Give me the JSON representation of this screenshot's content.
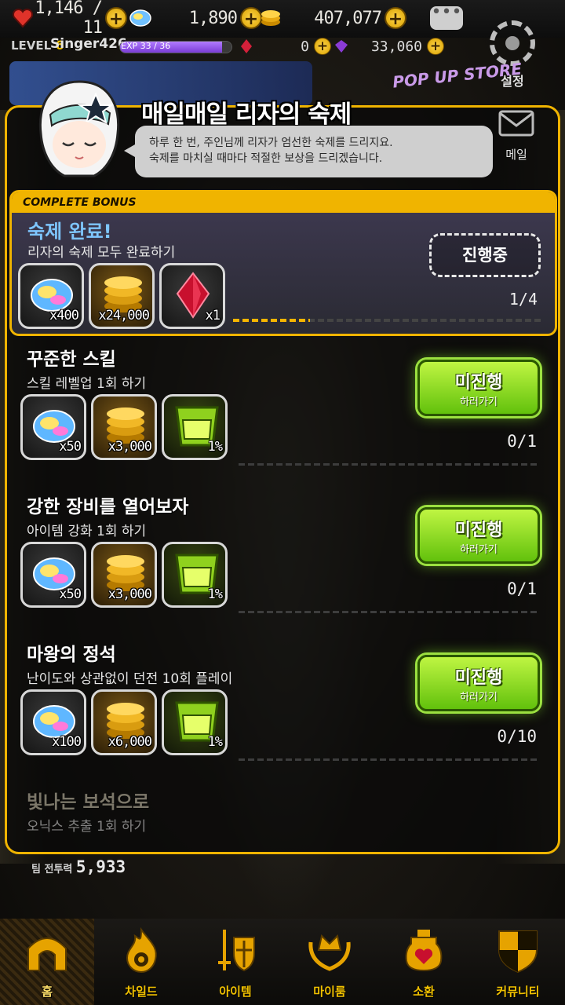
{
  "resources": {
    "hearts": "1,146 / 11",
    "gems": "1,890",
    "gold": "407,077"
  },
  "player": {
    "level_label": "LEVEL",
    "level": "6",
    "nickname": "Singer426",
    "exp_text": "EXP 33 / 36",
    "exp_fraction": 0.917,
    "red_crystal": "0",
    "purple_crystal": "33,060"
  },
  "settings_label": "설정",
  "popup_store": "POP UP STORE",
  "side_menu": {
    "mail": "메일"
  },
  "panel": {
    "title": "매일매일 리자의 숙제",
    "speech": "하루 한 번, 주인님께 리자가 엄선한 숙제를 드리지요.\n숙제를 마치실 때마다 적절한 보상을 드리겠습니다."
  },
  "complete_bonus": {
    "tag": "COMPLETE BONUS",
    "title": "숙제 완료!",
    "subtitle": "리자의 숙제 모두 완료하기",
    "button": "진행중",
    "count": "1/4",
    "progress_fraction": 0.25,
    "rewards": [
      {
        "icon": "rainbow-gem-icon",
        "qty": "x400"
      },
      {
        "icon": "gold-coins-icon",
        "qty": "x24,000"
      },
      {
        "icon": "red-crystal-icon",
        "qty": "x1"
      }
    ]
  },
  "missions": [
    {
      "title": "꾸준한 스킬",
      "subtitle": "스킬 레벨업 1회 하기",
      "button_main": "미진행",
      "button_sub": "하러가기",
      "count": "0/1",
      "rewards": [
        {
          "icon": "rainbow-gem-icon",
          "qty": "x50"
        },
        {
          "icon": "gold-coins-icon",
          "qty": "x3,000"
        },
        {
          "icon": "user-exp-icon",
          "qty": "1%"
        }
      ]
    },
    {
      "title": "강한 장비를 열어보자",
      "subtitle": "아이템 강화 1회 하기",
      "button_main": "미진행",
      "button_sub": "하러가기",
      "count": "0/1",
      "rewards": [
        {
          "icon": "rainbow-gem-icon",
          "qty": "x50"
        },
        {
          "icon": "gold-coins-icon",
          "qty": "x3,000"
        },
        {
          "icon": "user-exp-icon",
          "qty": "1%"
        }
      ]
    },
    {
      "title": "마왕의 정석",
      "subtitle": "난이도와 상관없이 던전 10회 플레이",
      "button_main": "미진행",
      "button_sub": "하러가기",
      "count": "0/10",
      "rewards": [
        {
          "icon": "rainbow-gem-icon",
          "qty": "x100"
        },
        {
          "icon": "gold-coins-icon",
          "qty": "x6,000"
        },
        {
          "icon": "user-exp-icon",
          "qty": "1%"
        }
      ]
    },
    {
      "title": "빛나는 보석으로",
      "subtitle": "오닉스 추출 1회 하기"
    }
  ],
  "team_power": {
    "label": "팀 전투력",
    "value": "5,933"
  },
  "nav": [
    {
      "label": "홈",
      "icon": "home-arch-icon",
      "active": true
    },
    {
      "label": "차일드",
      "icon": "flame-icon",
      "active": false
    },
    {
      "label": "아이템",
      "icon": "sword-shield-icon",
      "active": false
    },
    {
      "label": "마이룸",
      "icon": "crown-laurel-icon",
      "active": false
    },
    {
      "label": "소환",
      "icon": "potion-heart-icon",
      "active": false
    },
    {
      "label": "커뮤니티",
      "icon": "checkered-shield-icon",
      "active": false
    }
  ],
  "colors": {
    "accent": "#f0b400",
    "go_button": "#8fe021",
    "bonus_title": "#7ec6ff"
  }
}
